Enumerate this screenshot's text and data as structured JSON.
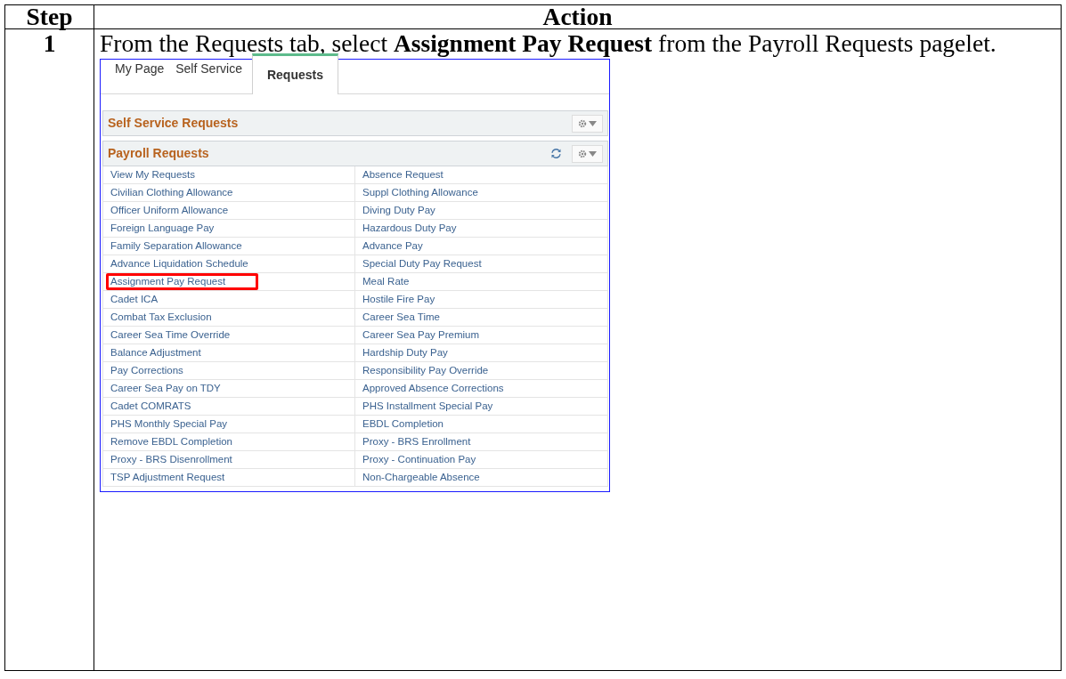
{
  "table": {
    "columns": [
      "Step",
      "Action"
    ],
    "rows": [
      {
        "step": "1",
        "instruction": "From the Requests tab, select **Assignment Pay Request** from the Payroll Requests pagelet.",
        "screenshot": {
          "tabs": [
            {
              "label": "My Page",
              "selected": false
            },
            {
              "label": "Self Service",
              "selected": false
            },
            {
              "label": "Requests",
              "selected": true
            }
          ],
          "pagelets": [
            {
              "title": "Self Service Requests",
              "refresh": false
            },
            {
              "title": "Payroll Requests",
              "refresh": true,
              "links": [
                {
                  "label": "View My Requests",
                  "highlighted": false
                },
                {
                  "label": "Absence Request",
                  "highlighted": false
                },
                {
                  "label": "Civilian Clothing Allowance",
                  "highlighted": false
                },
                {
                  "label": "Suppl Clothing Allowance",
                  "highlighted": false
                },
                {
                  "label": "Officer Uniform Allowance",
                  "highlighted": false
                },
                {
                  "label": "Diving Duty Pay",
                  "highlighted": false
                },
                {
                  "label": "Foreign Language Pay",
                  "highlighted": false
                },
                {
                  "label": "Hazardous Duty Pay",
                  "highlighted": false
                },
                {
                  "label": "Family Separation Allowance",
                  "highlighted": false
                },
                {
                  "label": "Advance Pay",
                  "highlighted": false
                },
                {
                  "label": "Advance Liquidation Schedule",
                  "highlighted": false
                },
                {
                  "label": "Special Duty Pay Request",
                  "highlighted": false
                },
                {
                  "label": "Assignment Pay Request",
                  "highlighted": true
                },
                {
                  "label": "Meal Rate",
                  "highlighted": false
                },
                {
                  "label": "Cadet ICA",
                  "highlighted": false
                },
                {
                  "label": "Hostile Fire Pay",
                  "highlighted": false
                },
                {
                  "label": "Combat Tax Exclusion",
                  "highlighted": false
                },
                {
                  "label": "Career Sea Time",
                  "highlighted": false
                },
                {
                  "label": "Career Sea Time Override",
                  "highlighted": false
                },
                {
                  "label": "Career Sea Pay Premium",
                  "highlighted": false
                },
                {
                  "label": "Balance Adjustment",
                  "highlighted": false
                },
                {
                  "label": "Hardship Duty Pay",
                  "highlighted": false
                },
                {
                  "label": "Pay Corrections",
                  "highlighted": false
                },
                {
                  "label": "Responsibility Pay Override",
                  "highlighted": false
                },
                {
                  "label": "Career Sea Pay on TDY",
                  "highlighted": false
                },
                {
                  "label": "Approved Absence Corrections",
                  "highlighted": false
                },
                {
                  "label": "Cadet COMRATS",
                  "highlighted": false
                },
                {
                  "label": "PHS Installment Special Pay",
                  "highlighted": false
                },
                {
                  "label": "PHS Monthly Special Pay",
                  "highlighted": false
                },
                {
                  "label": "EBDL Completion",
                  "highlighted": false
                },
                {
                  "label": "Remove EBDL Completion",
                  "highlighted": false
                },
                {
                  "label": "Proxy - BRS Enrollment",
                  "highlighted": false
                },
                {
                  "label": "Proxy - BRS Disenrollment",
                  "highlighted": false
                },
                {
                  "label": "Proxy - Continuation Pay",
                  "highlighted": false
                },
                {
                  "label": "TSP Adjustment Request",
                  "highlighted": false
                },
                {
                  "label": "Non-Chargeable Absence",
                  "highlighted": false
                }
              ]
            }
          ]
        }
      }
    ]
  }
}
